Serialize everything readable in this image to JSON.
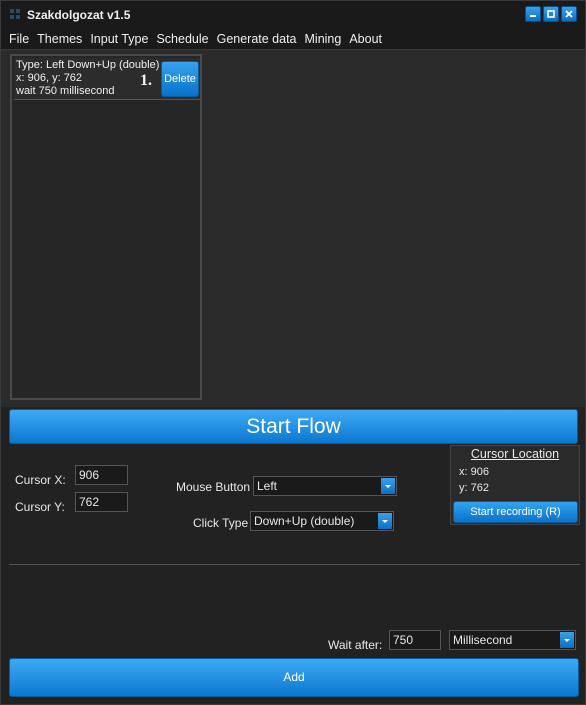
{
  "window": {
    "title": "Szakdolgozat v1.5"
  },
  "menu": [
    "File",
    "Themes",
    "Input Type",
    "Schedule",
    "Generate data",
    "Mining",
    "About"
  ],
  "flow": {
    "items": [
      {
        "line1": "Type: Left Down+Up (double)",
        "line2": "x: 906, y: 762",
        "line3": "wait 750 millisecond",
        "number": "1.",
        "delete_label": "Delete"
      }
    ]
  },
  "start_flow_label": "Start Flow",
  "inputs": {
    "cursor_x_label": "Cursor X:",
    "cursor_x_value": "906",
    "cursor_y_label": "Cursor Y:",
    "cursor_y_value": "762",
    "mouse_button_label": "Mouse Button",
    "mouse_button_value": "Left",
    "click_type_label": "Click Type",
    "click_type_value": "Down+Up (double)"
  },
  "cursor_location": {
    "title": "Cursor Location",
    "x_text": "x: 906",
    "y_text": "y: 762",
    "record_label": "Start recording (R)"
  },
  "wait": {
    "label": "Wait after:",
    "value": "750",
    "unit": "Millisecond"
  },
  "add_label": "Add",
  "colors": {
    "accent": "#1a8ee0",
    "background": "#222222",
    "titlebar": "#1a1a1a"
  }
}
